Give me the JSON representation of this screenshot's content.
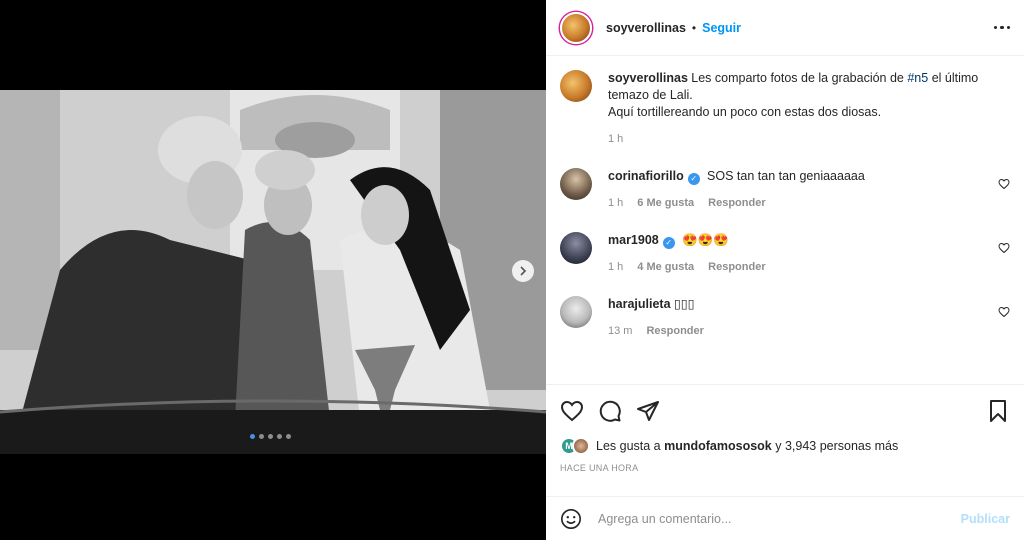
{
  "header": {
    "username": "soyverollinas",
    "separator": "•",
    "follow_label": "Seguir",
    "more_icon": "more-horizontal-icon"
  },
  "caption": {
    "username": "soyverollinas",
    "text_before": "Les comparto fotos de la grabación de ",
    "hashtag": "#n5",
    "text_after": " el último temazo de Lali.",
    "line2": "Aquí tortillereando un poco con estas dos diosas.",
    "time": "1 h"
  },
  "comments": [
    {
      "username": "corinafiorillo",
      "verified": true,
      "text": "SOS tan tan tan geniaaaaaa",
      "time": "1 h",
      "likes": "6 Me gusta",
      "reply": "Responder"
    },
    {
      "username": "mar1908",
      "verified": true,
      "text": "😍😍😍",
      "time": "1 h",
      "likes": "4 Me gusta",
      "reply": "Responder"
    },
    {
      "username": "harajulieta",
      "verified": false,
      "text": "▯▯▯",
      "time": "13 m",
      "reply": "Responder"
    }
  ],
  "likes": {
    "prefix": "Les gusta a ",
    "user": "mundofamososok",
    "suffix": " y 3,943 personas más",
    "avatar_initial": "M"
  },
  "timestamp": "HACE UNA HORA",
  "add_comment": {
    "placeholder": "Agrega un comentario...",
    "publish_label": "Publicar"
  },
  "carousel": {
    "total": 5,
    "active_index": 0
  },
  "colors": {
    "link": "#0095f6",
    "hashtag": "#00376b",
    "muted": "#8e8e8e",
    "publish_disabled": "#b2dffc",
    "verified": "#3897f0"
  }
}
